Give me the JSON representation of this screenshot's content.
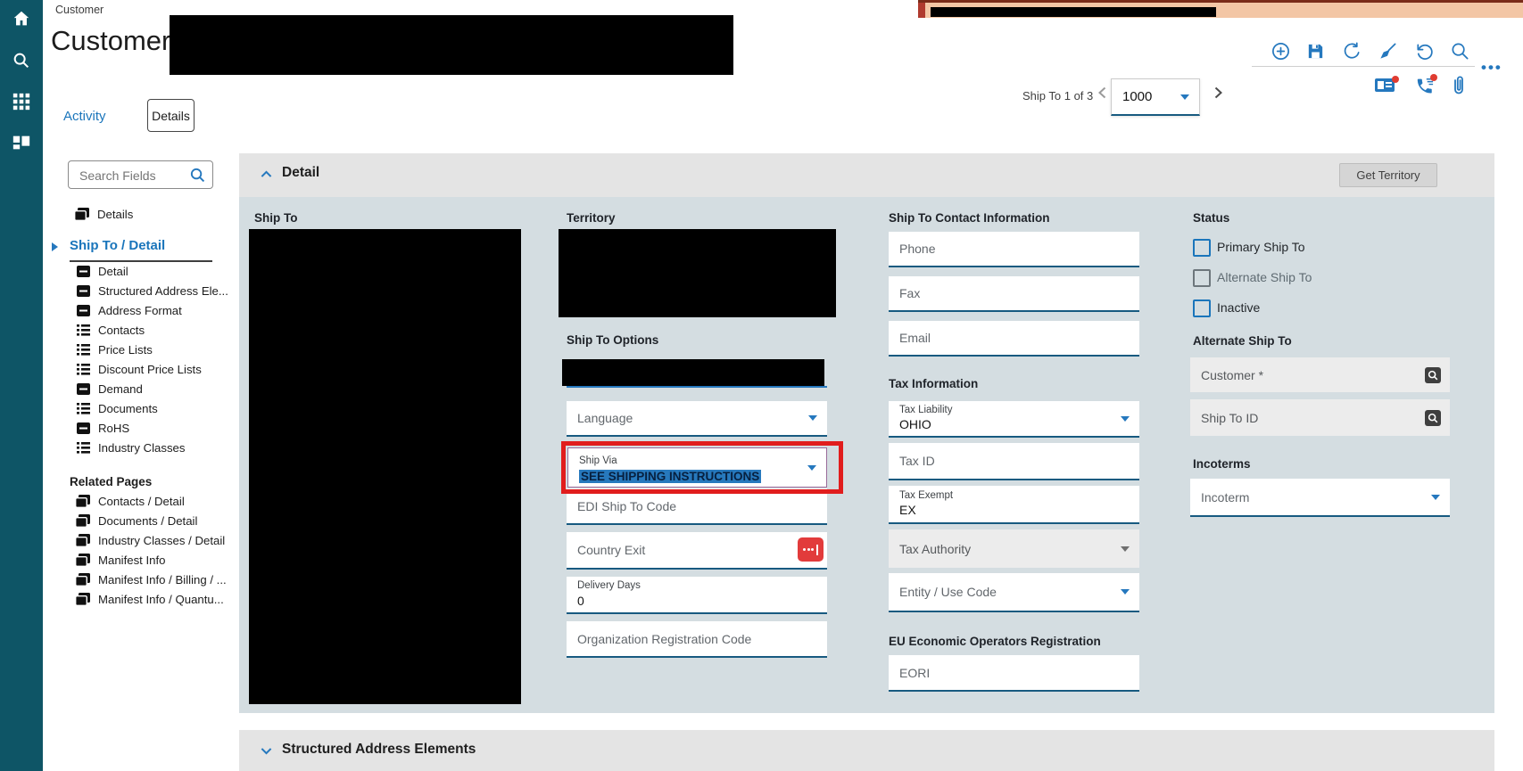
{
  "app": {
    "breadcrumb": "Customer",
    "title": "Customer",
    "tabs": {
      "activity": "Activity",
      "details": "Details"
    },
    "record_nav": {
      "label": "Ship To 1 of 3",
      "value": "1000"
    },
    "toolbar_icons": [
      "new",
      "save",
      "refresh",
      "clean",
      "undo",
      "search",
      "more"
    ],
    "contact_icons": [
      "contact-card",
      "phone-call",
      "attachment"
    ],
    "nav_icons": [
      "home",
      "search",
      "apps",
      "dashboard"
    ]
  },
  "sidebar": {
    "search_placeholder": "Search Fields",
    "root_item": "Details",
    "active_item": "Ship To / Detail",
    "items": [
      {
        "label": "Detail",
        "icon": "form"
      },
      {
        "label": "Structured Address Ele...",
        "icon": "form"
      },
      {
        "label": "Address Format",
        "icon": "form"
      },
      {
        "label": "Contacts",
        "icon": "list"
      },
      {
        "label": "Price Lists",
        "icon": "list"
      },
      {
        "label": "Discount Price Lists",
        "icon": "list"
      },
      {
        "label": "Demand",
        "icon": "form"
      },
      {
        "label": "Documents",
        "icon": "list"
      },
      {
        "label": "RoHS",
        "icon": "form"
      },
      {
        "label": "Industry Classes",
        "icon": "list"
      }
    ],
    "related_header": "Related Pages",
    "related_items": [
      {
        "label": "Contacts / Detail"
      },
      {
        "label": "Documents / Detail"
      },
      {
        "label": "Industry Classes / Detail"
      },
      {
        "label": "Manifest Info"
      },
      {
        "label": "Manifest Info / Billing / ..."
      },
      {
        "label": "Manifest Info / Quantu..."
      }
    ]
  },
  "detail": {
    "section_title": "Detail",
    "get_territory": "Get Territory",
    "ship_to_label": "Ship To",
    "territory_label": "Territory",
    "ship_to_options_label": "Ship To Options",
    "fields": {
      "language": "Language",
      "ship_via_label": "Ship Via",
      "ship_via_value": "SEE SHIPPING INSTRUCTIONS",
      "edi": "EDI Ship To Code",
      "country_exit": "Country Exit",
      "delivery_days_label": "Delivery Days",
      "delivery_days_value": "0",
      "org_reg": "Organization Registration Code"
    },
    "contact": {
      "header": "Ship To Contact Information",
      "phone": "Phone",
      "fax": "Fax",
      "email": "Email"
    },
    "tax": {
      "header": "Tax Information",
      "liability_label": "Tax Liability",
      "liability_value": "OHIO",
      "tax_id": "Tax ID",
      "exempt_label": "Tax Exempt",
      "exempt_value": "EX",
      "authority": "Tax Authority",
      "entity_use": "Entity / Use Code"
    },
    "eu": {
      "header": "EU Economic Operators Registration",
      "eori": "EORI"
    },
    "status": {
      "header": "Status",
      "checkboxes": [
        {
          "label": "Primary Ship To"
        },
        {
          "label": "Alternate Ship To"
        },
        {
          "label": "Inactive"
        }
      ]
    },
    "alternate": {
      "header": "Alternate Ship To",
      "customer": "Customer *",
      "ship_to_id": "Ship To ID"
    },
    "incoterms": {
      "header": "Incoterms",
      "incoterm": "Incoterm"
    }
  },
  "sections": {
    "structured_address": "Structured Address Elements"
  },
  "colors": {
    "accent_blue": "#1a75bb",
    "nav_teal": "#0e5566",
    "section_body": "#d4dde1",
    "field_border": "#175a80",
    "annotation_red": "#e11d1d",
    "selection_blue": "#2779bd",
    "alert_red": "#e23b3b",
    "strip_peach": "#f3c6a5"
  }
}
